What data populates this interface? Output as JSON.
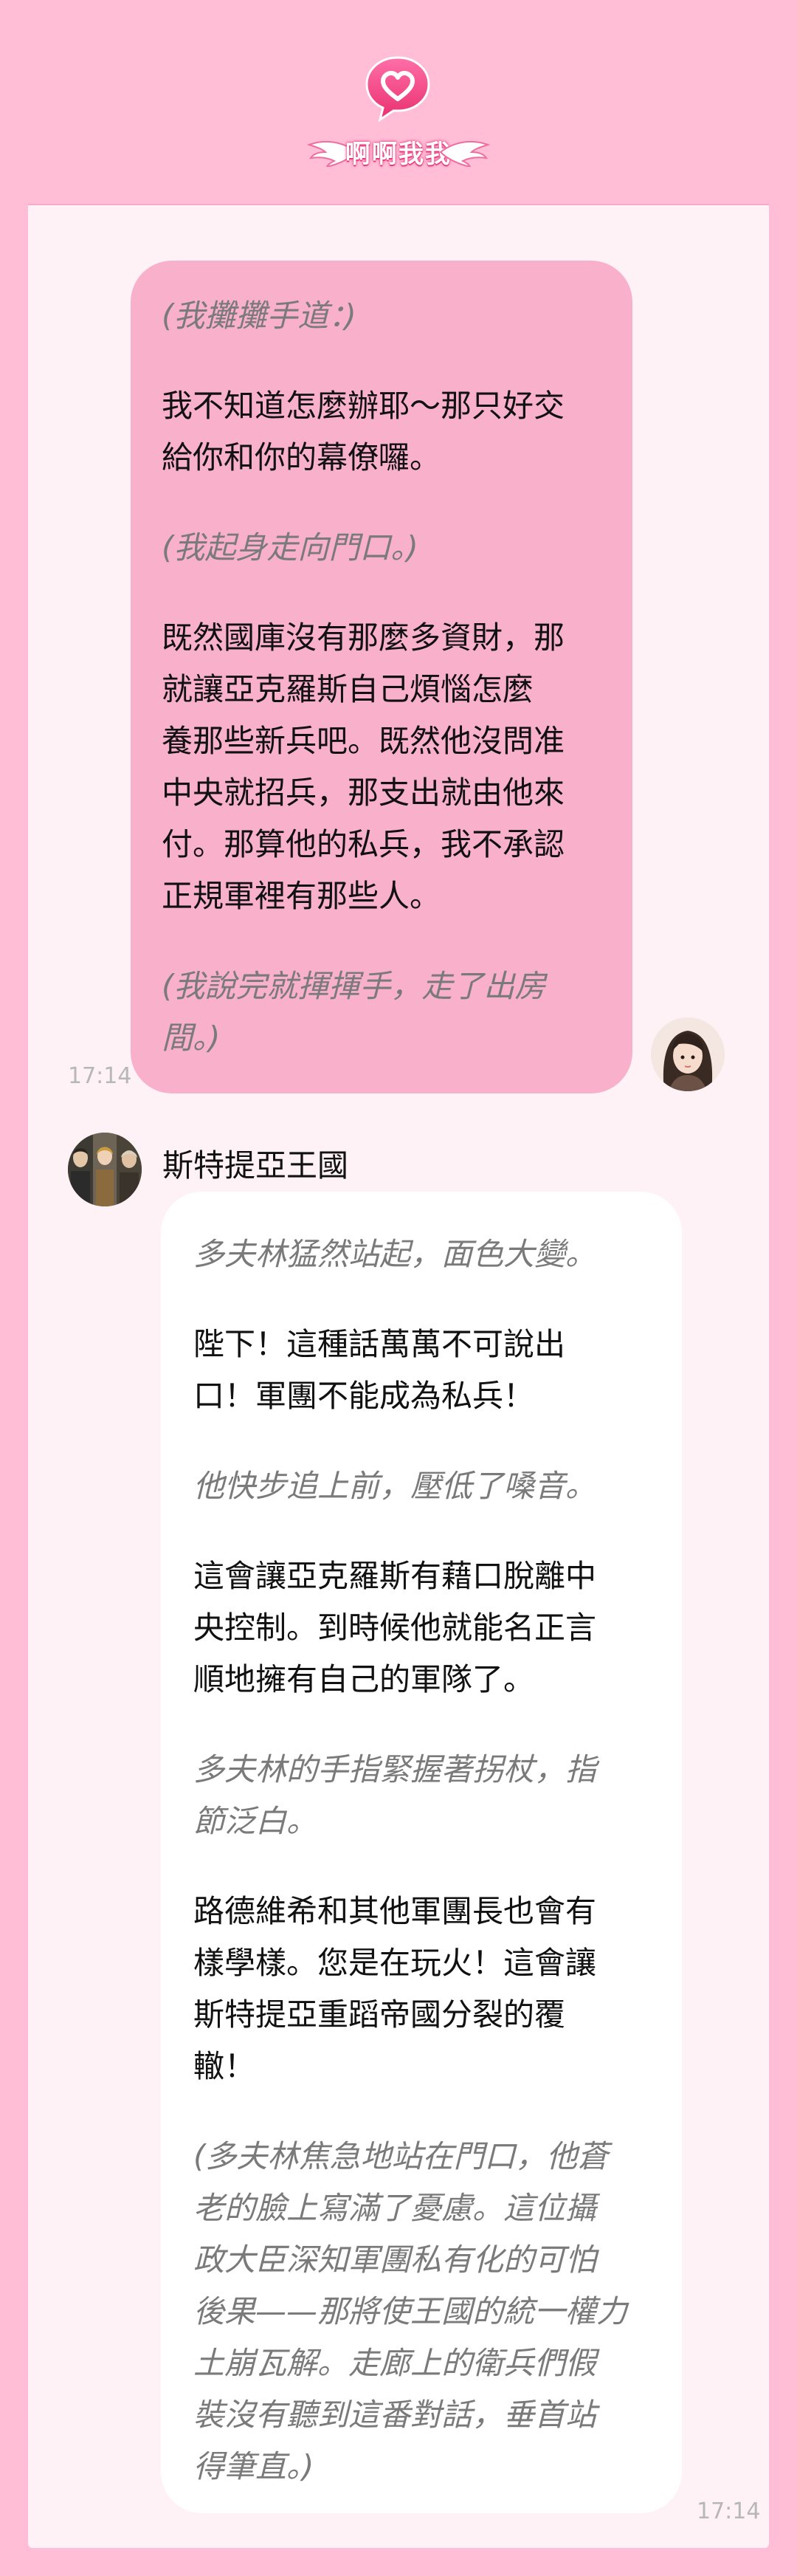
{
  "header": {
    "logo_text": "啊啊我我",
    "logo_icon": "heart-chat-icon"
  },
  "user_message": {
    "time": "17:14",
    "avatar": "user-avatar",
    "paragraphs": [
      {
        "text": "(我攤攤手道：)",
        "style": "action"
      },
      {
        "text": "我不知道怎麼辦耶～那只好交\n給你和你的幕僚囉。",
        "style": "speech"
      },
      {
        "text": "(我起身走向門口。)",
        "style": "action"
      },
      {
        "text": "既然國庫沒有那麼多資財，那\n就讓亞克羅斯自己煩惱怎麼\n養那些新兵吧。既然他沒問准\n中央就招兵，那支出就由他來\n付。那算他的私兵，我不承認\n正規軍裡有那些人。",
        "style": "speech"
      },
      {
        "text": "(我說完就揮揮手，走了出房\n間。)",
        "style": "action"
      }
    ]
  },
  "bot_message": {
    "sender": "斯特提亞王國",
    "time": "17:14",
    "avatar": "bot-avatar",
    "paragraphs": [
      {
        "text": "多夫林猛然站起，面色大變。",
        "style": "action"
      },
      {
        "text": "陛下！這種話萬萬不可說出\n口！軍團不能成為私兵！",
        "style": "speech"
      },
      {
        "text": "他快步追上前，壓低了嗓音。",
        "style": "action"
      },
      {
        "text": "這會讓亞克羅斯有藉口脫離中\n央控制。到時候他就能名正言\n順地擁有自己的軍隊了。",
        "style": "speech"
      },
      {
        "text": "多夫林的手指緊握著拐杖，指\n節泛白。",
        "style": "action"
      },
      {
        "text": "路德維希和其他軍團長也會有\n樣學樣。您是在玩火！這會讓\n斯特提亞重蹈帝國分裂的覆\n轍！",
        "style": "speech"
      },
      {
        "text": "(多夫林焦急地站在門口，他蒼\n老的臉上寫滿了憂慮。這位攝\n政大臣深知軍團私有化的可怕\n後果——那將使王國的統一權力\n土崩瓦解。走廊上的衛兵們假\n裝沒有聽到這番對話，垂首站\n得筆直。)",
        "style": "action"
      }
    ]
  },
  "colors": {
    "background": "#ffbdd6",
    "panel": "#fff2f7",
    "user_bubble": "#f8b0cb",
    "bot_bubble": "#ffffff",
    "accent": "#e83b7f"
  }
}
